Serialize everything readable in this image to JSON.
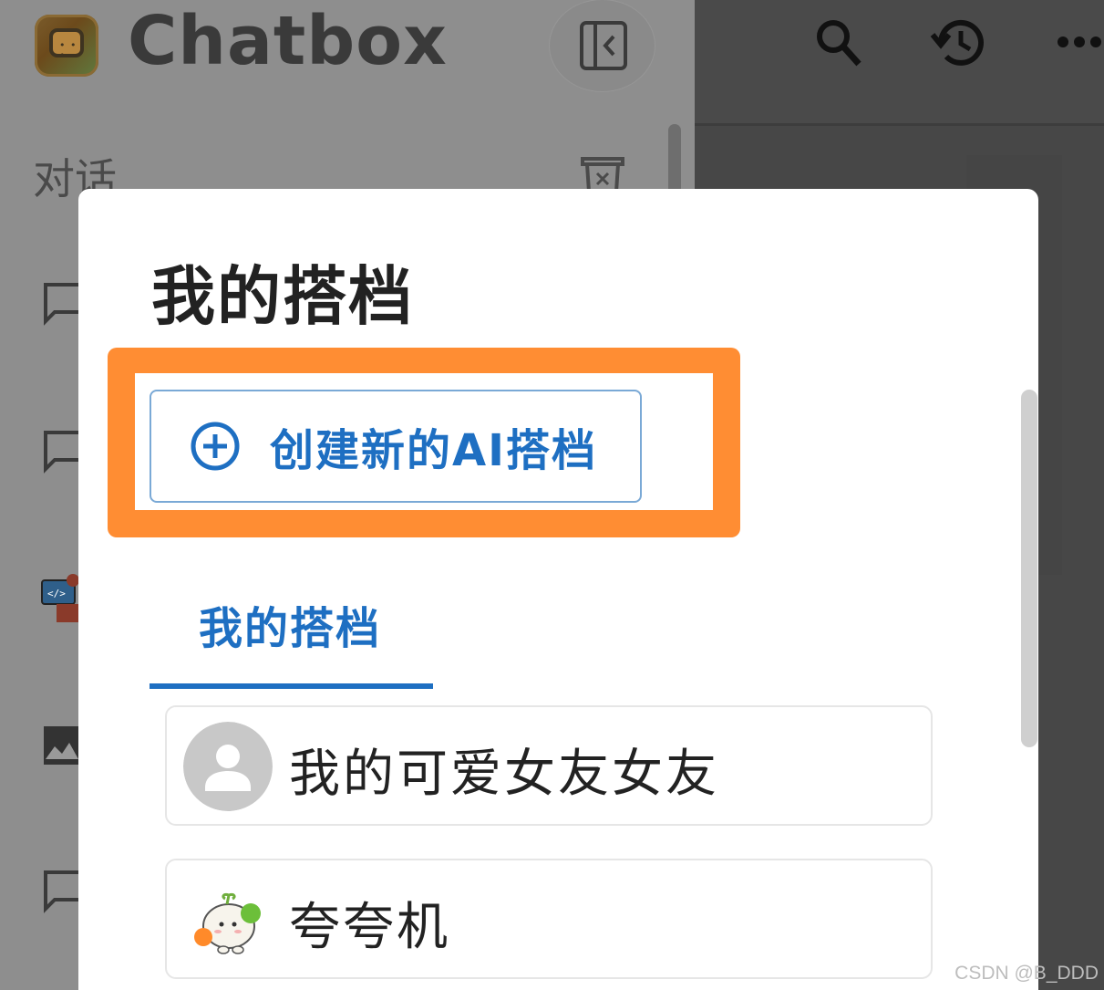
{
  "app": {
    "title": "Chatbox",
    "section_label": "对话"
  },
  "modal": {
    "title": "我的搭档",
    "create_button_label": "创建新的AI搭档",
    "highlight_color": "#ff8d33",
    "accent_color": "#1e6fc2",
    "tabs": [
      {
        "label": "我的搭档",
        "active": true
      }
    ],
    "partners": [
      {
        "name": "我的可爱女友女友",
        "avatar": "default-user-avatar"
      },
      {
        "name": "夸夸机",
        "avatar": "cheerleader-sheep-avatar"
      }
    ]
  },
  "icons": {
    "top_bar": [
      "search-icon",
      "history-icon",
      "more-icon"
    ],
    "sidebar": [
      "collapse-sidebar-icon",
      "trash-icon",
      "chat-bubble-icon",
      "image-icon"
    ]
  },
  "watermark": "CSDN @B_DDD"
}
